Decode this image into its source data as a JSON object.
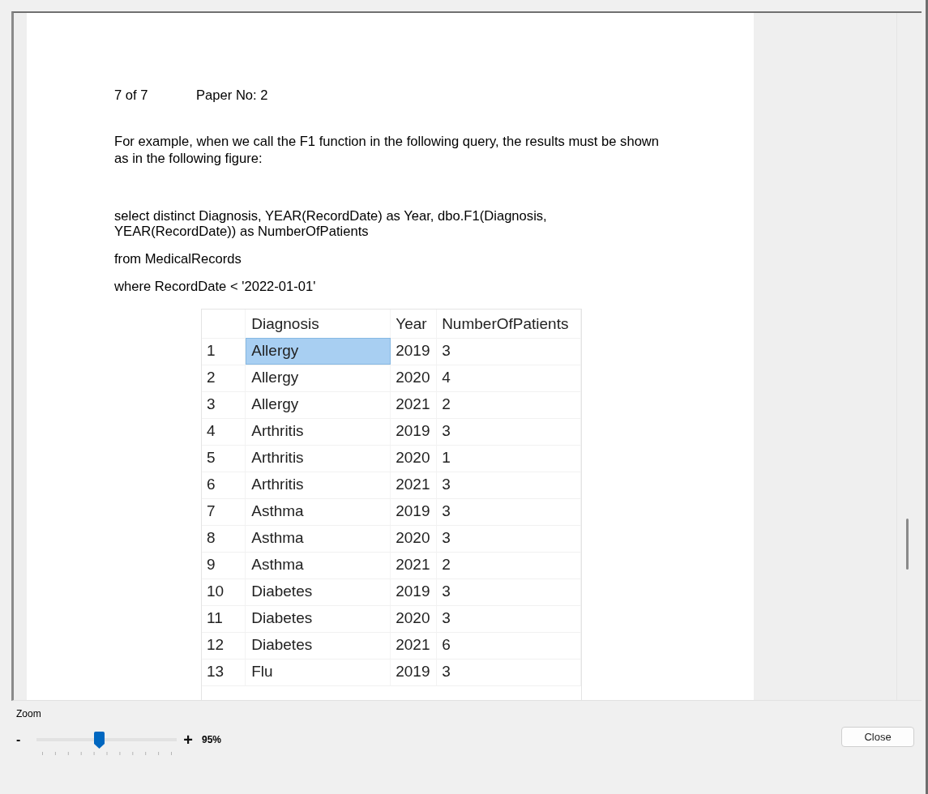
{
  "document": {
    "page_indicator": "7 of 7",
    "paper_number": "Paper No: 2",
    "intro": "For example, when we call the F1 function in the following query, the results must be shown as in the following figure:",
    "query_lines": [
      "select distinct Diagnosis, YEAR(RecordDate) as Year, dbo.F1(Diagnosis, YEAR(RecordDate)) as NumberOfPatients",
      "from MedicalRecords",
      "where RecordDate < '2022-01-01'"
    ]
  },
  "result_grid": {
    "columns": [
      "Diagnosis",
      "Year",
      "NumberOfPatients"
    ],
    "rows": [
      {
        "number": "1",
        "diagnosis": "Allergy",
        "year": "2019",
        "patients": "3",
        "selected": true
      },
      {
        "number": "2",
        "diagnosis": "Allergy",
        "year": "2020",
        "patients": "4",
        "selected": false
      },
      {
        "number": "3",
        "diagnosis": "Allergy",
        "year": "2021",
        "patients": "2",
        "selected": false
      },
      {
        "number": "4",
        "diagnosis": "Arthritis",
        "year": "2019",
        "patients": "3",
        "selected": false
      },
      {
        "number": "5",
        "diagnosis": "Arthritis",
        "year": "2020",
        "patients": "1",
        "selected": false
      },
      {
        "number": "6",
        "diagnosis": "Arthritis",
        "year": "2021",
        "patients": "3",
        "selected": false
      },
      {
        "number": "7",
        "diagnosis": "Asthma",
        "year": "2019",
        "patients": "3",
        "selected": false
      },
      {
        "number": "8",
        "diagnosis": "Asthma",
        "year": "2020",
        "patients": "3",
        "selected": false
      },
      {
        "number": "9",
        "diagnosis": "Asthma",
        "year": "2021",
        "patients": "2",
        "selected": false
      },
      {
        "number": "10",
        "diagnosis": "Diabetes",
        "year": "2019",
        "patients": "3",
        "selected": false
      },
      {
        "number": "11",
        "diagnosis": "Diabetes",
        "year": "2020",
        "patients": "3",
        "selected": false
      },
      {
        "number": "12",
        "diagnosis": "Diabetes",
        "year": "2021",
        "patients": "6",
        "selected": false
      },
      {
        "number": "13",
        "diagnosis": "Flu",
        "year": "2019",
        "patients": "3",
        "selected": false
      }
    ]
  },
  "zoom_control": {
    "label": "Zoom",
    "zoom_out": "-",
    "zoom_in": "+",
    "level": 0.45,
    "reading": "95%"
  },
  "buttons": [
    "Close"
  ]
}
